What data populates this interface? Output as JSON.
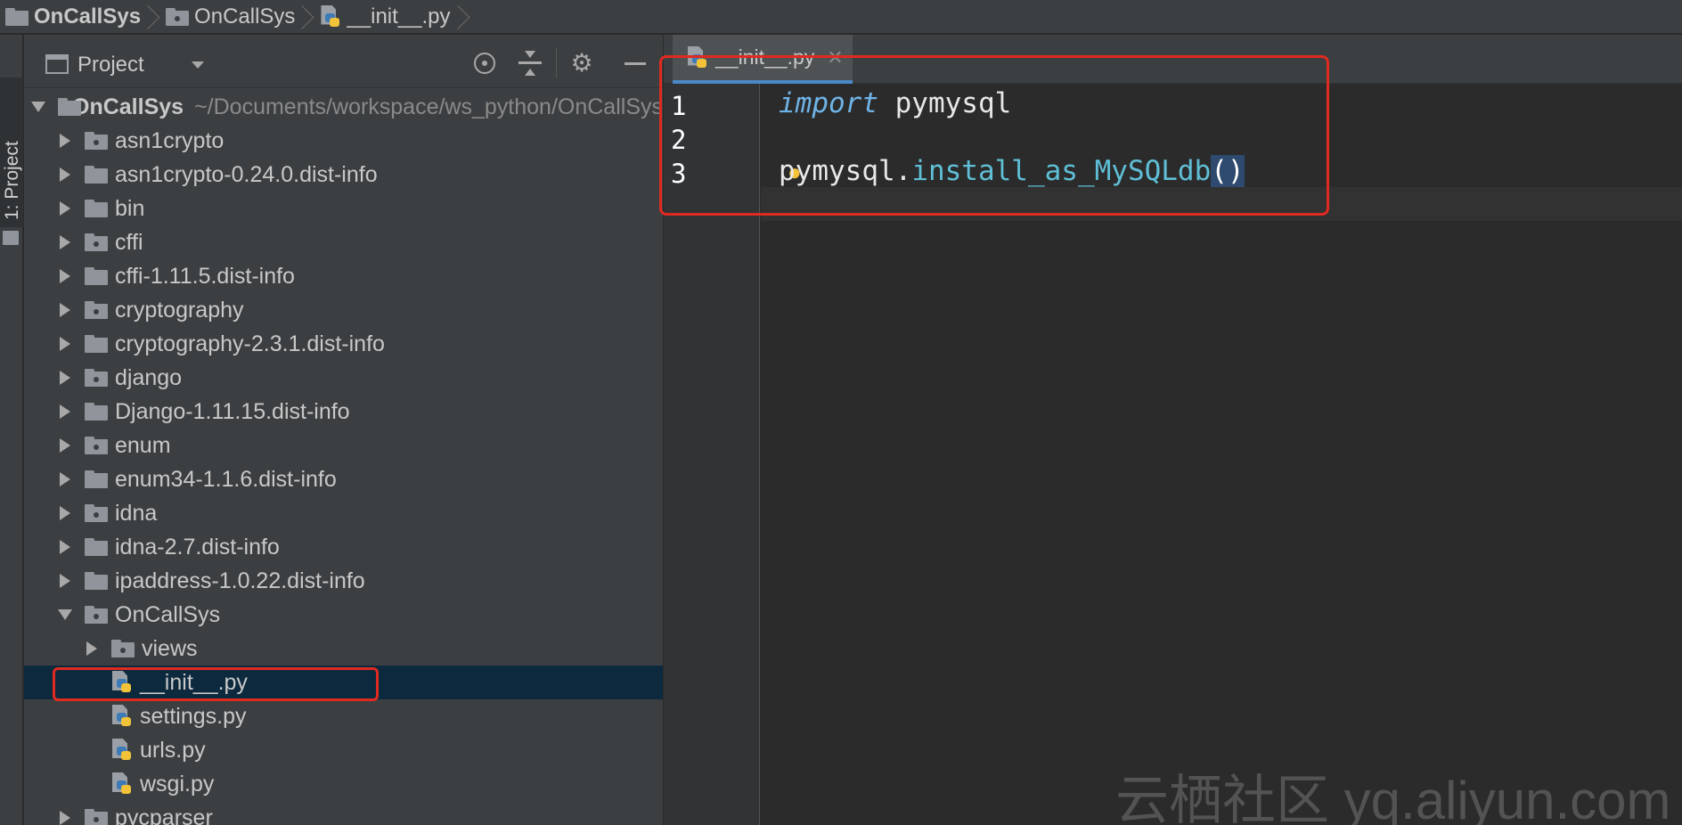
{
  "breadcrumb": {
    "items": [
      {
        "label": "OnCallSys",
        "icon": "folder-icon",
        "bold": true
      },
      {
        "label": "OnCallSys",
        "icon": "package-folder-icon",
        "bold": false
      },
      {
        "label": "__init__.py",
        "icon": "python-file-icon",
        "bold": false
      }
    ]
  },
  "left_strip": {
    "tab_label": "1: Project"
  },
  "project_panel": {
    "title": "Project",
    "tree": [
      {
        "depth": 0,
        "arrow": "down",
        "icon": "folder",
        "label": "OnCallSys",
        "bold": true,
        "path": "~/Documents/workspace/ws_python/OnCallSys"
      },
      {
        "depth": 1,
        "arrow": "right",
        "icon": "package",
        "label": "asn1crypto"
      },
      {
        "depth": 1,
        "arrow": "right",
        "icon": "folder",
        "label": "asn1crypto-0.24.0.dist-info"
      },
      {
        "depth": 1,
        "arrow": "right",
        "icon": "folder",
        "label": "bin"
      },
      {
        "depth": 1,
        "arrow": "right",
        "icon": "package",
        "label": "cffi"
      },
      {
        "depth": 1,
        "arrow": "right",
        "icon": "folder",
        "label": "cffi-1.11.5.dist-info"
      },
      {
        "depth": 1,
        "arrow": "right",
        "icon": "package",
        "label": "cryptography"
      },
      {
        "depth": 1,
        "arrow": "right",
        "icon": "folder",
        "label": "cryptography-2.3.1.dist-info"
      },
      {
        "depth": 1,
        "arrow": "right",
        "icon": "package",
        "label": "django"
      },
      {
        "depth": 1,
        "arrow": "right",
        "icon": "folder",
        "label": "Django-1.11.15.dist-info"
      },
      {
        "depth": 1,
        "arrow": "right",
        "icon": "package",
        "label": "enum"
      },
      {
        "depth": 1,
        "arrow": "right",
        "icon": "folder",
        "label": "enum34-1.1.6.dist-info"
      },
      {
        "depth": 1,
        "arrow": "right",
        "icon": "package",
        "label": "idna"
      },
      {
        "depth": 1,
        "arrow": "right",
        "icon": "folder",
        "label": "idna-2.7.dist-info"
      },
      {
        "depth": 1,
        "arrow": "right",
        "icon": "folder",
        "label": "ipaddress-1.0.22.dist-info"
      },
      {
        "depth": 1,
        "arrow": "down",
        "icon": "package",
        "label": "OnCallSys"
      },
      {
        "depth": 2,
        "arrow": "right",
        "icon": "package",
        "label": "views"
      },
      {
        "depth": 2,
        "arrow": "none",
        "icon": "python",
        "label": "__init__.py",
        "selected": true
      },
      {
        "depth": 2,
        "arrow": "none",
        "icon": "python",
        "label": "settings.py"
      },
      {
        "depth": 2,
        "arrow": "none",
        "icon": "python",
        "label": "urls.py"
      },
      {
        "depth": 2,
        "arrow": "none",
        "icon": "python",
        "label": "wsgi.py"
      },
      {
        "depth": 1,
        "arrow": "right",
        "icon": "package",
        "label": "pycparser"
      }
    ]
  },
  "editor": {
    "tab_label": "__init__.py",
    "line_numbers": [
      "1",
      "2",
      "3"
    ],
    "lines": {
      "l1_keyword": "import",
      "l1_rest": " pymysql",
      "l3_obj": "pymysql.",
      "l3_func": "install_as_MySQLdb",
      "l3_parens": "()"
    }
  },
  "watermark": "云栖社区 yq.aliyun.com",
  "colors": {
    "accent": "#4a88c7",
    "highlight_border": "#e02a20",
    "keyword": "#6fb3e6",
    "selection": "#0d293e"
  }
}
